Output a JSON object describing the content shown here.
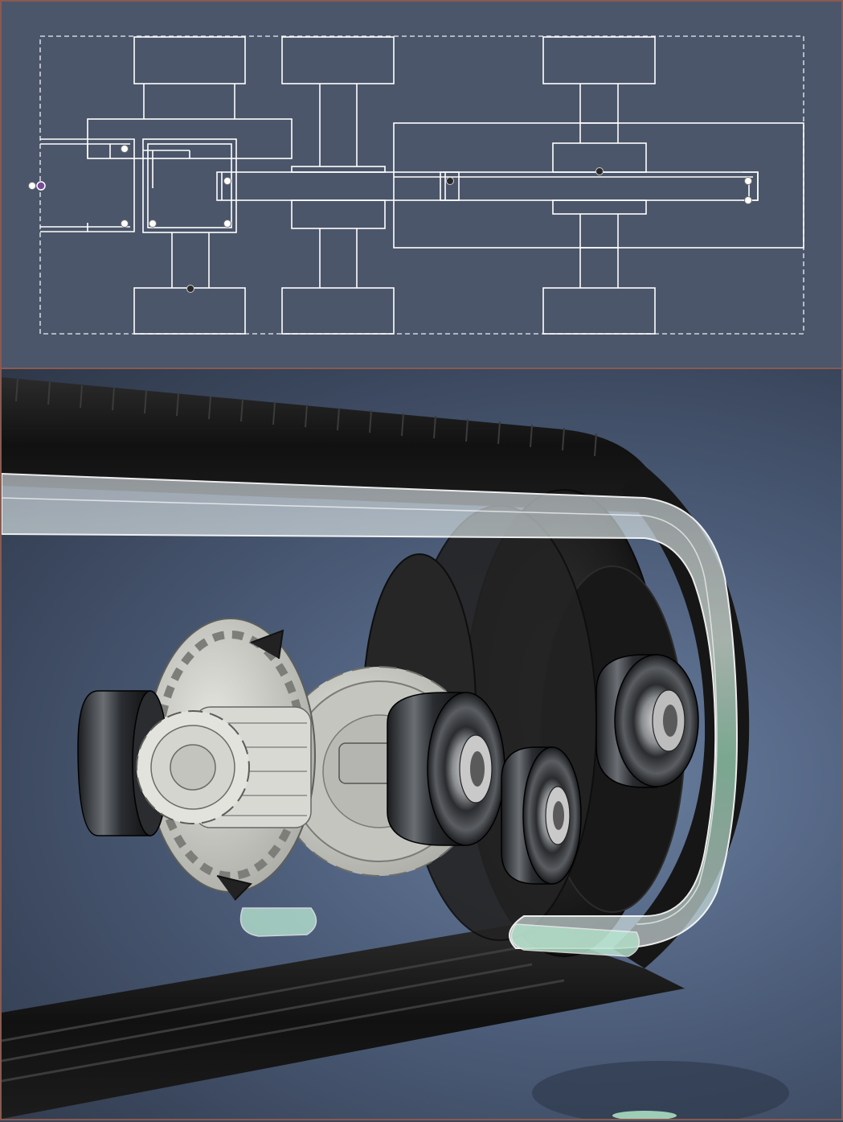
{
  "colors": {
    "sketch_background": "#4b566a",
    "sketch_line": "#ffffff",
    "panel_border": "#8a5a50",
    "render_background": "#4e5f7c",
    "belt": "#1a1a1a",
    "gear": "#cfcfc9",
    "bearing": "#2f3236",
    "glass_highlight": "#b8f0d0"
  },
  "icons": {
    "constraint_point_hollow": "circle-white",
    "constraint_point_fixed": "circle-dark",
    "origin_point": "circle-purple"
  }
}
